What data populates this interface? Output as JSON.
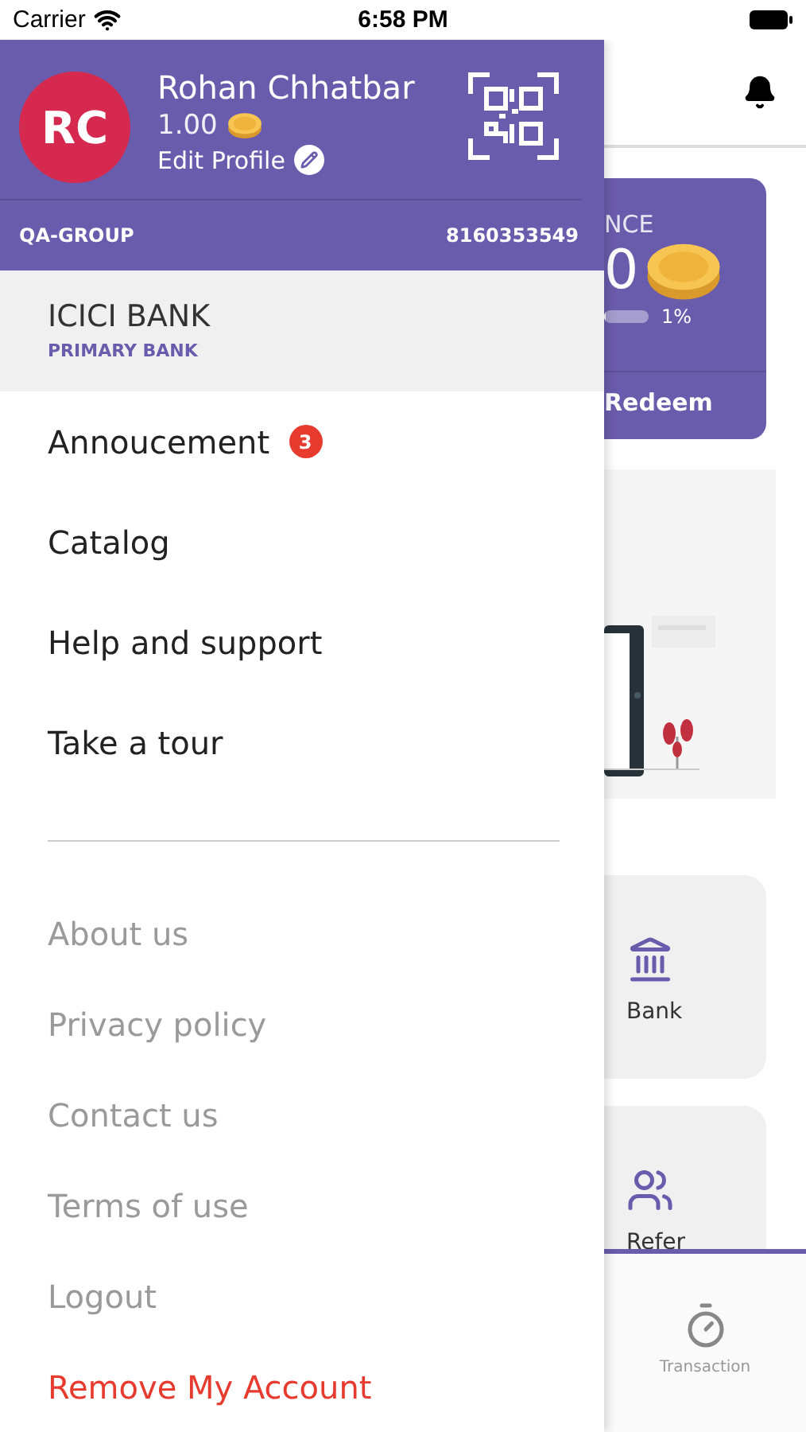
{
  "status_bar": {
    "carrier": "Carrier",
    "time": "6:58 PM"
  },
  "drawer": {
    "profile": {
      "initials": "RC",
      "name": "Rohan Chhatbar",
      "points": "1.00",
      "edit_label": "Edit Profile",
      "group": "QA-GROUP",
      "phone": "8160353549"
    },
    "bank": {
      "name": "ICICI BANK",
      "caption": "PRIMARY BANK"
    },
    "menu": [
      {
        "label": "Annoucement",
        "badge": "3"
      },
      {
        "label": "Catalog"
      },
      {
        "label": "Help and support"
      },
      {
        "label": "Take a tour"
      }
    ],
    "links": [
      {
        "label": "About us",
        "kind": "plain"
      },
      {
        "label": "Privacy policy",
        "kind": "plain"
      },
      {
        "label": "Contact us",
        "kind": "plain"
      },
      {
        "label": "Terms of use",
        "kind": "plain"
      },
      {
        "label": "Logout",
        "kind": "plain"
      },
      {
        "label": "Remove My Account",
        "kind": "danger"
      }
    ]
  },
  "background": {
    "balance_card": {
      "title": "NCE",
      "amount": "0",
      "progress": {
        "level": 0.01
      },
      "percent": "1%",
      "action": "Redeem"
    },
    "tiles": [
      {
        "label": "Bank",
        "kind": "bank"
      },
      {
        "label": "Refer",
        "kind": "refer"
      }
    ],
    "tab_bar": [
      {
        "label": "Transaction",
        "selected": false
      }
    ]
  }
}
